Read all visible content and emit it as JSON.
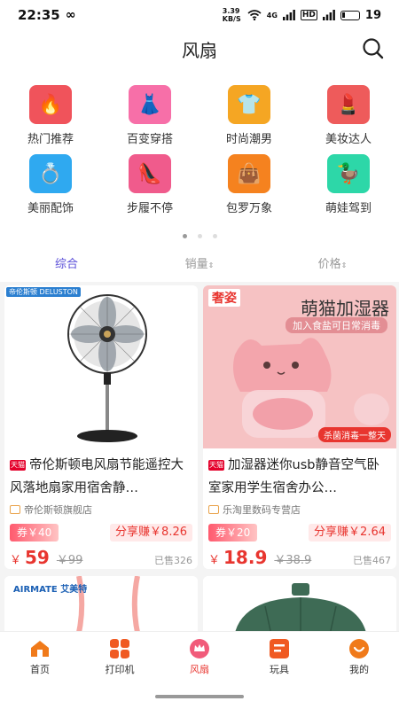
{
  "status": {
    "time": "22:35",
    "net_speed": "3.39 KB/S",
    "signal": "4G",
    "battery": "19"
  },
  "header": {
    "title": "风扇"
  },
  "categories": [
    {
      "label": "热门推荐",
      "icon": "flame-icon",
      "color": "#f0535b",
      "glyph": "🔥"
    },
    {
      "label": "百变穿搭",
      "icon": "dress-icon",
      "color": "#f76fa8",
      "glyph": "👗"
    },
    {
      "label": "时尚潮男",
      "icon": "tshirt-icon",
      "color": "#f5a623",
      "glyph": "👕"
    },
    {
      "label": "美妆达人",
      "icon": "lipstick-icon",
      "color": "#ee5b5b",
      "glyph": "💄"
    },
    {
      "label": "美丽配饰",
      "icon": "accessory-icon",
      "color": "#2fa9f0",
      "glyph": "💍"
    },
    {
      "label": "步履不停",
      "icon": "heel-icon",
      "color": "#f05b8c",
      "glyph": "👠"
    },
    {
      "label": "包罗万象",
      "icon": "bag-icon",
      "color": "#f5821f",
      "glyph": "👜"
    },
    {
      "label": "萌娃驾到",
      "icon": "duck-icon",
      "color": "#2dd7a8",
      "glyph": "🦆"
    }
  ],
  "sort": {
    "comprehensive": "综合",
    "sales": "销量",
    "price": "价格"
  },
  "products": [
    {
      "title": "帝伦斯顿电风扇节能遥控大风落地扇家用宿舍静…",
      "shop": "帝伦斯顿旗舰店",
      "coupon": "券￥40",
      "share": "分享赚￥8.26",
      "currency": "￥",
      "price": "59",
      "old_price": "￥99",
      "sold": "已售326",
      "brand": "帝伦斯顿 DELUSTON"
    },
    {
      "title": "加湿器迷你usb静音空气卧室家用学生宿舍办公…",
      "shop": "乐淘里数码专营店",
      "coupon": "券￥20",
      "share": "分享赚￥2.64",
      "currency": "￥",
      "price": "18.9",
      "old_price": "￥38.9",
      "sold": "已售467",
      "brand": "奢姿",
      "banner": "萌猫加湿器",
      "sub_banner": "加入食盐可日常消毒",
      "tag": "杀菌消毒一整天"
    },
    {
      "brand": "AIRMATE 艾美特"
    },
    {}
  ],
  "nav": [
    {
      "label": "首页",
      "icon": "home-icon"
    },
    {
      "label": "打印机",
      "icon": "grid-icon"
    },
    {
      "label": "风扇",
      "icon": "crown-icon",
      "active": true
    },
    {
      "label": "玩具",
      "icon": "list-icon"
    },
    {
      "label": "我的",
      "icon": "smile-icon"
    }
  ],
  "colors": {
    "accent": "#e8352f",
    "sort_active": "#5b4fd8"
  }
}
